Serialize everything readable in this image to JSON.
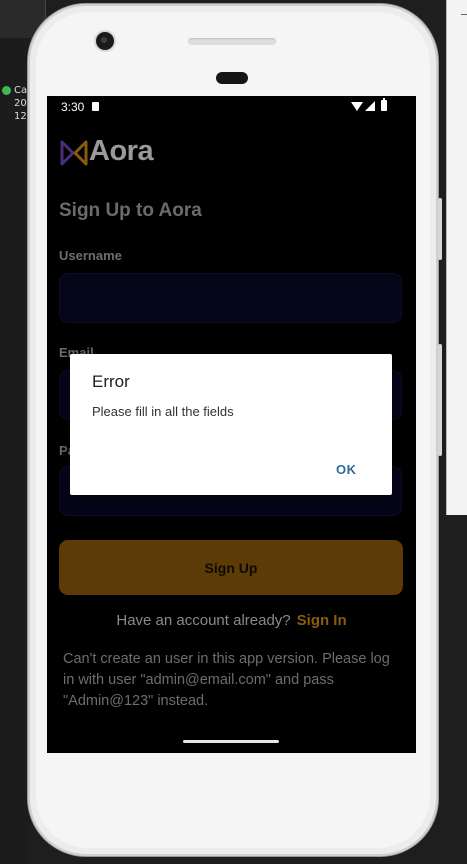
{
  "desktop": {
    "notification_lines": [
      "Ca",
      "20",
      "12"
    ]
  },
  "status_bar": {
    "time": "3:30"
  },
  "app": {
    "logo_text": "Aora",
    "page_title": "Sign Up to Aora",
    "fields": {
      "username_label": "Username",
      "email_label": "Email",
      "password_label": "Pa",
      "username_value": "",
      "email_value": "",
      "password_value": ""
    },
    "signup_button": "Sign Up",
    "have_account_text": "Have an account already?",
    "signin_link": "Sign In",
    "note": "Can't create an user in this app version. Please log in with user \"admin@email.com\" and pass \"Admin@123\" instead."
  },
  "dialog": {
    "title": "Error",
    "message": "Please fill in all the fields",
    "ok_button": "OK"
  },
  "colors": {
    "background": "#000000",
    "field_bg": "#05051a",
    "button_bg": "#5c3b06",
    "link": "#8a5b0e",
    "dialog_ok": "#2f6a96"
  },
  "icons": [
    "sd-card-icon",
    "wifi-icon",
    "cell-signal-icon",
    "battery-icon",
    "aora-logo-icon",
    "eye-icon",
    "check-circle-icon"
  ]
}
